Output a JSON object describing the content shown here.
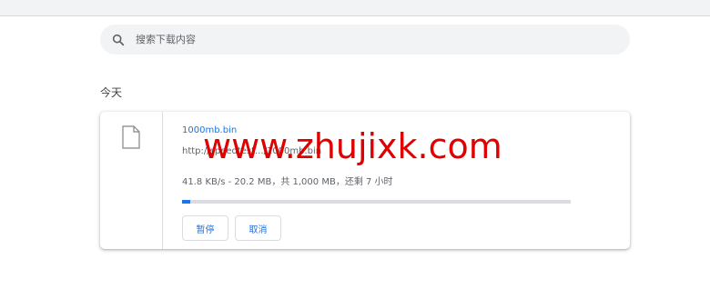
{
  "search": {
    "placeholder": "搜索下载内容"
  },
  "date_header": "今天",
  "download": {
    "file_name": "1000mb.bin",
    "url": "http://speedtest.../1000mb.bin",
    "status": "41.8 KB/s - 20.2 MB，共 1,000 MB，还剩 7 小时",
    "progress_fraction": 0.02,
    "pause_label": "暂停",
    "cancel_label": "取消"
  },
  "watermark": "www.zhujixk.com",
  "colors": {
    "accent": "#1a73e8",
    "watermark": "#e00000"
  },
  "icons": {
    "search": "search-icon",
    "file": "file-icon"
  }
}
